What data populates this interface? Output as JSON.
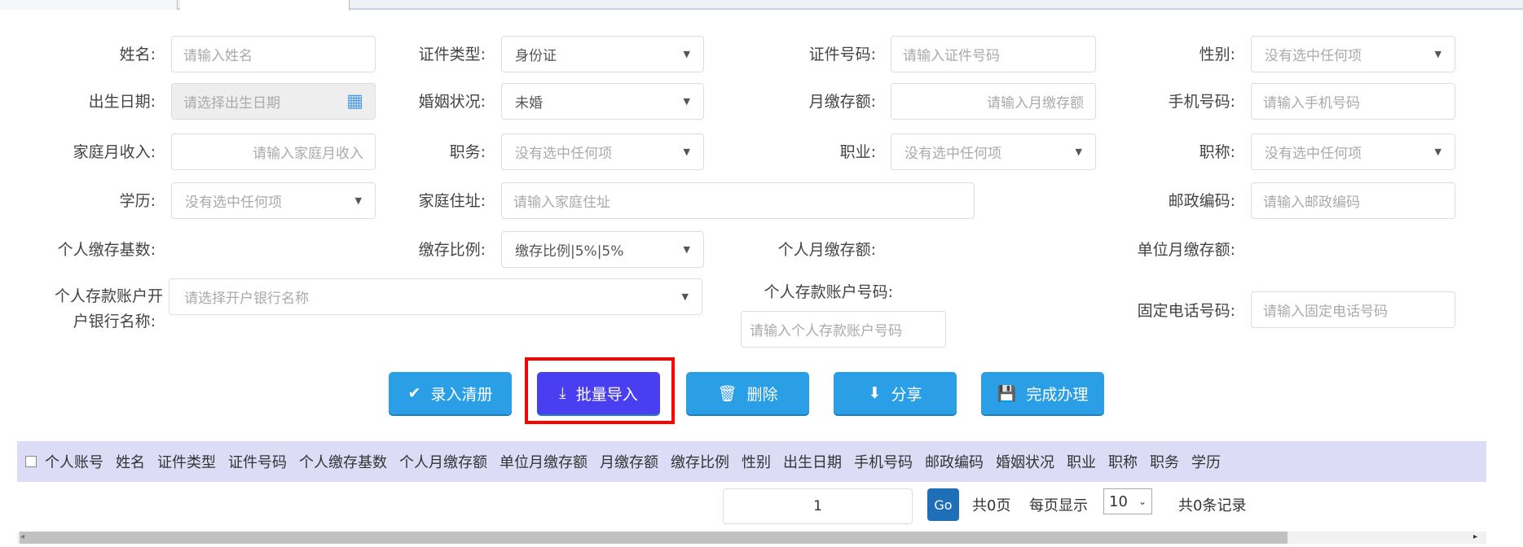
{
  "form": {
    "name": {
      "label": "姓名:",
      "placeholder": "请输入姓名"
    },
    "id_type": {
      "label": "证件类型:",
      "value": "身份证"
    },
    "id_number": {
      "label": "证件号码:",
      "placeholder": "请输入证件号码"
    },
    "gender": {
      "label": "性别:",
      "value": "没有选中任何项"
    },
    "birth_date": {
      "label": "出生日期:",
      "placeholder": "请选择出生日期"
    },
    "marital": {
      "label": "婚姻状况:",
      "value": "未婚"
    },
    "monthly_deposit": {
      "label": "月缴存额:",
      "placeholder": "请输入月缴存额"
    },
    "mobile": {
      "label": "手机号码:",
      "placeholder": "请输入手机号码"
    },
    "family_income": {
      "label": "家庭月收入:",
      "placeholder": "请输入家庭月收入"
    },
    "position": {
      "label": "职务:",
      "value": "没有选中任何项"
    },
    "occupation": {
      "label": "职业:",
      "value": "没有选中任何项"
    },
    "title": {
      "label": "职称:",
      "value": "没有选中任何项"
    },
    "education": {
      "label": "学历:",
      "value": "没有选中任何项"
    },
    "address": {
      "label": "家庭住址:",
      "placeholder": "请输入家庭住址"
    },
    "postcode": {
      "label": "邮政编码:",
      "placeholder": "请输入邮政编码"
    },
    "personal_base": {
      "label": "个人缴存基数:"
    },
    "ratio": {
      "label": "缴存比例:",
      "value": "缴存比例|5%|5%"
    },
    "personal_monthly": {
      "label": "个人月缴存额:"
    },
    "unit_monthly": {
      "label": "单位月缴存额:"
    },
    "bank_name": {
      "label_line1": "个人存款账户开",
      "label_line2": "户银行名称:",
      "placeholder": "请选择开户银行名称"
    },
    "account_no": {
      "label": "个人存款账户号码:",
      "placeholder": "请输入个人存款账户号码"
    },
    "landline": {
      "label": "固定电话号码:",
      "placeholder": "请输入固定电话号码"
    }
  },
  "buttons": {
    "register": "录入清册",
    "batch_import": "批量导入",
    "delete": "删除",
    "share": "分享",
    "finish": "完成办理"
  },
  "table": {
    "headers": [
      "个人账号",
      "姓名",
      "证件类型",
      "证件号码",
      "个人缴存基数",
      "个人月缴存额",
      "单位月缴存额",
      "月缴存额",
      "缴存比例",
      "性别",
      "出生日期",
      "手机号码",
      "邮政编码",
      "婚姻状况",
      "职业",
      "职称",
      "职务",
      "学历"
    ]
  },
  "pagination": {
    "page": "1",
    "go": "Go",
    "total_pages": "共0页",
    "per_page_label": "每页显示",
    "per_page": "10",
    "total_records": "共0条记录"
  },
  "colors": {
    "button": "#2b9fe6",
    "active_button": "#4a3ff0",
    "highlight": "#ff0000",
    "table_header": "#dcdcf7"
  }
}
